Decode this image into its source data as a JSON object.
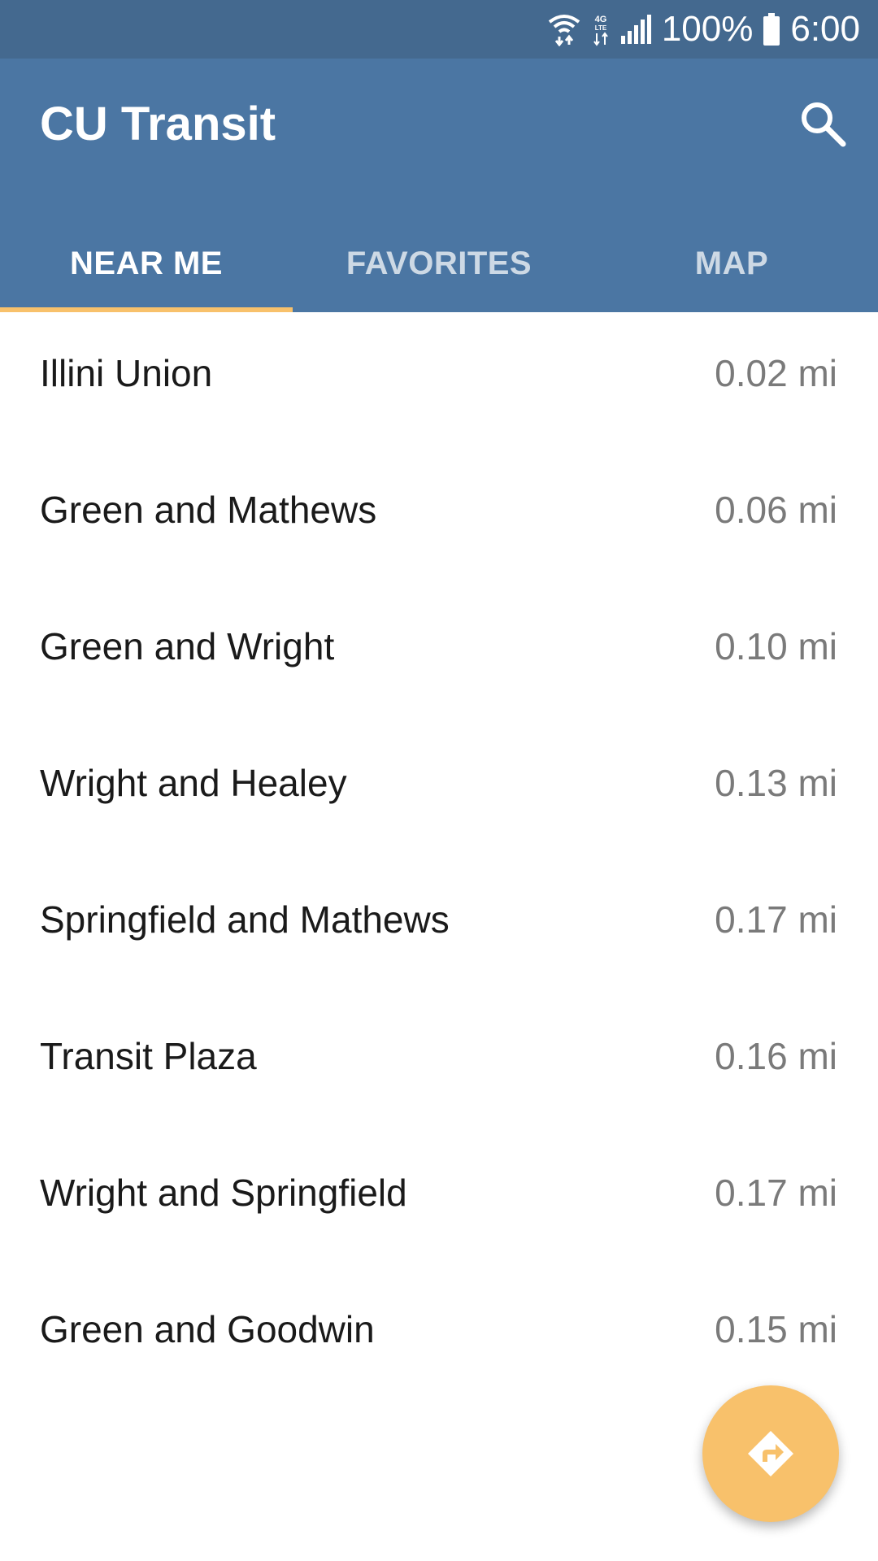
{
  "status_bar": {
    "battery_percent": "100%",
    "time": "6:00",
    "icons": [
      "wifi-icon",
      "lte-icon",
      "signal-icon",
      "battery-icon"
    ],
    "network_label": "4G LTE"
  },
  "app_bar": {
    "title": "CU Transit",
    "search_icon": "search-icon"
  },
  "tabs": [
    {
      "label": "NEAR ME",
      "active": true
    },
    {
      "label": "FAVORITES",
      "active": false
    },
    {
      "label": "MAP",
      "active": false
    }
  ],
  "stops": [
    {
      "name": "Illini Union",
      "distance": "0.02 mi"
    },
    {
      "name": "Green and Mathews",
      "distance": "0.06 mi"
    },
    {
      "name": "Green and Wright",
      "distance": "0.10 mi"
    },
    {
      "name": "Wright and Healey",
      "distance": "0.13 mi"
    },
    {
      "name": "Springfield and Mathews",
      "distance": "0.17 mi"
    },
    {
      "name": "Transit Plaza",
      "distance": "0.16 mi"
    },
    {
      "name": "Wright and Springfield",
      "distance": "0.17 mi"
    },
    {
      "name": "Green and Goodwin",
      "distance": "0.15 mi"
    }
  ],
  "fab": {
    "icon": "directions-icon"
  },
  "colors": {
    "status_bar": "#44698f",
    "app_bar": "#4b76a3",
    "accent": "#f8c16b",
    "distance_text": "#7a7a7a"
  }
}
